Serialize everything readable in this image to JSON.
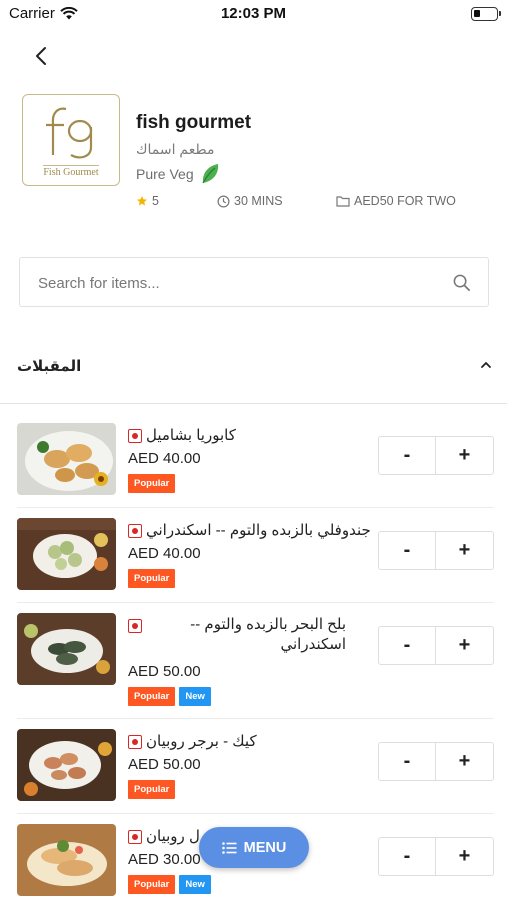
{
  "status_bar": {
    "carrier": "Carrier",
    "time": "12:03 PM",
    "battery_level": 0.3
  },
  "restaurant": {
    "logo_caption": "Fish Gourmet",
    "name": "fish gourmet",
    "arabic_name": "مطعم اسماك",
    "veg_label": "Pure Veg",
    "rating": "5",
    "delivery_time": "30 MINS",
    "cost_for_two": "AED50 FOR TWO"
  },
  "search": {
    "placeholder": "Search for items..."
  },
  "section": {
    "title": "المقبلات"
  },
  "items": [
    {
      "name": "كابوريا بشاميل",
      "price": "AED 40.00",
      "badges": [
        "Popular"
      ]
    },
    {
      "name": "جندوفلي بالزبده والتوم -- اسكندراني",
      "price": "AED 40.00",
      "badges": [
        "Popular"
      ]
    },
    {
      "name": "بلح البحر بالزبده والتوم -- اسكندراني",
      "price": "AED 50.00",
      "badges": [
        "Popular",
        "New"
      ]
    },
    {
      "name": "كيك - برجر روبيان",
      "price": "AED 50.00",
      "badges": [
        "Popular"
      ]
    },
    {
      "name": "ل روبيان",
      "price": "AED 30.00",
      "badges": [
        "Popular",
        "New"
      ]
    }
  ],
  "stepper": {
    "minus": "-",
    "plus": "+"
  },
  "fab": {
    "label": "MENU"
  },
  "colors": {
    "popular": "#ff5722",
    "new": "#2196f3",
    "fab": "#5a8fe3",
    "nonveg": "#d62828",
    "star": "#f4b400",
    "leaf": "#4caf50"
  }
}
